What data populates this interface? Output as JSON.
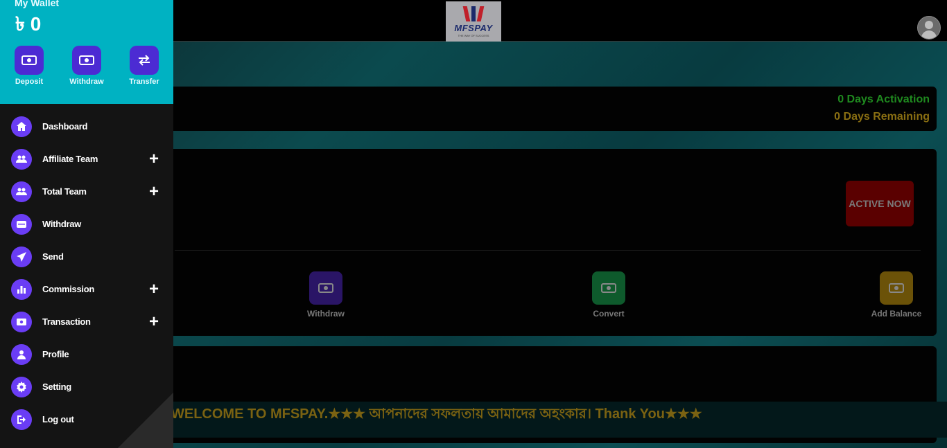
{
  "header": {
    "logo_text": "MFSPAY",
    "logo_tagline": "THE WAY OF SUCCESS"
  },
  "wallet": {
    "title": "My Wallet",
    "balance": "৳ 0",
    "actions": [
      {
        "label": "Deposit",
        "icon": "cash-exchange-icon"
      },
      {
        "label": "Withdraw",
        "icon": "cash-exchange-icon"
      },
      {
        "label": "Transfer",
        "icon": "transfer-arrows-icon"
      }
    ]
  },
  "menu": {
    "items": [
      {
        "label": "Dashboard",
        "icon": "home-icon",
        "expandable": false
      },
      {
        "label": "Affiliate Team",
        "icon": "users-icon",
        "expandable": true
      },
      {
        "label": "Total Team",
        "icon": "users-icon",
        "expandable": true
      },
      {
        "label": "Withdraw",
        "icon": "card-icon",
        "expandable": false
      },
      {
        "label": "Send",
        "icon": "paper-plane-icon",
        "expandable": false
      },
      {
        "label": "Commission",
        "icon": "bar-chart-icon",
        "expandable": true
      },
      {
        "label": "Transaction",
        "icon": "cash-icon",
        "expandable": true
      },
      {
        "label": "Profile",
        "icon": "user-icon",
        "expandable": false
      },
      {
        "label": "Setting",
        "icon": "gear-icon",
        "expandable": false
      },
      {
        "label": "Log out",
        "icon": "logout-icon",
        "expandable": false
      }
    ],
    "expand_symbol": "+"
  },
  "status": {
    "activation": "0 Days Activation",
    "remaining": "0 Days Remaining"
  },
  "main": {
    "active_now_label": "ACTIVE NOW",
    "actions": [
      {
        "label": "Withdraw",
        "color": "#2a1566"
      },
      {
        "label": "Convert",
        "color": "#0e5a2c"
      },
      {
        "label": "Add Balance",
        "color": "#6b5208"
      }
    ]
  },
  "marquee": {
    "text": "WELCOME TO MFSPAY.★★★ আপনাদের সফলতায় আমাদের অহংকার। Thank  You★★★"
  },
  "colors": {
    "wallet_bg": "#00b2c2",
    "accent_purple": "#6a3df5",
    "activation_green": "#1f8a1f",
    "remaining_amber": "#8a6f12"
  }
}
